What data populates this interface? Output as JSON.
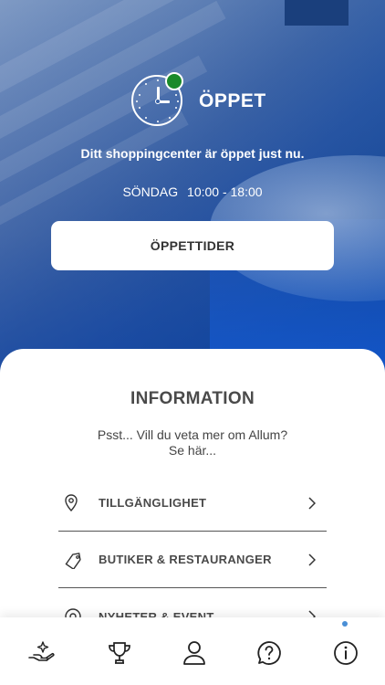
{
  "status": {
    "label": "ÖPPET",
    "message": "Ditt shoppingcenter är öppet just nu.",
    "day": "SÖNDAG",
    "hours": "10:00 - 18:00",
    "open_color": "#1a8a2a"
  },
  "hours_button": {
    "label": "ÖPPETTIDER"
  },
  "info": {
    "title": "INFORMATION",
    "text_line1": "Psst... Vill du veta mer om Allum?",
    "text_line2": "Se här...",
    "items": [
      {
        "label": "TILLGÄNGLIGHET",
        "icon": "location-pin-icon"
      },
      {
        "label": "BUTIKER & RESTAURANGER",
        "icon": "tag-icon"
      },
      {
        "label": "NYHETER & EVENT",
        "icon": "news-icon"
      }
    ]
  },
  "tabbar": {
    "tabs": [
      {
        "icon": "hand-sparkle-icon"
      },
      {
        "icon": "trophy-icon"
      },
      {
        "icon": "profile-icon"
      },
      {
        "icon": "help-icon"
      },
      {
        "icon": "info-icon",
        "active": true
      }
    ],
    "accent": "#4a8fd6"
  }
}
